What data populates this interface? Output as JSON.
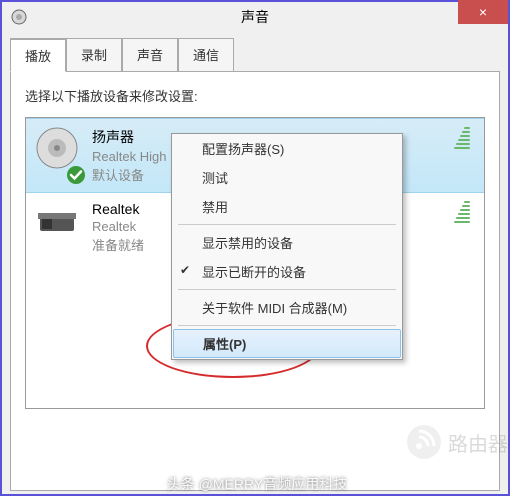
{
  "window": {
    "title": "声音",
    "close_label": "×"
  },
  "tabs": {
    "playback": "播放",
    "recording": "录制",
    "sounds": "声音",
    "communications": "通信"
  },
  "instruction": "选择以下播放设备来修改设置:",
  "devices": [
    {
      "name": "扬声器",
      "sub": "Realtek High Definition Audio",
      "status": "默认设备",
      "selected": true,
      "default": true
    },
    {
      "name": "Realtek",
      "sub": "Realtek",
      "status": "准备就绪",
      "selected": false,
      "default": false
    }
  ],
  "context_menu": {
    "items": {
      "configure": "配置扬声器(S)",
      "test": "测试",
      "disable": "禁用",
      "show_disabled": "显示禁用的设备",
      "show_disconnected": "显示已断开的设备",
      "about_midi": "关于软件 MIDI 合成器(M)",
      "properties": "属性(P)"
    },
    "checked": "show_disconnected",
    "highlighted": "properties"
  },
  "watermarks": {
    "router": "路由器",
    "footer": "头条 @MERRY音频应用科技"
  }
}
